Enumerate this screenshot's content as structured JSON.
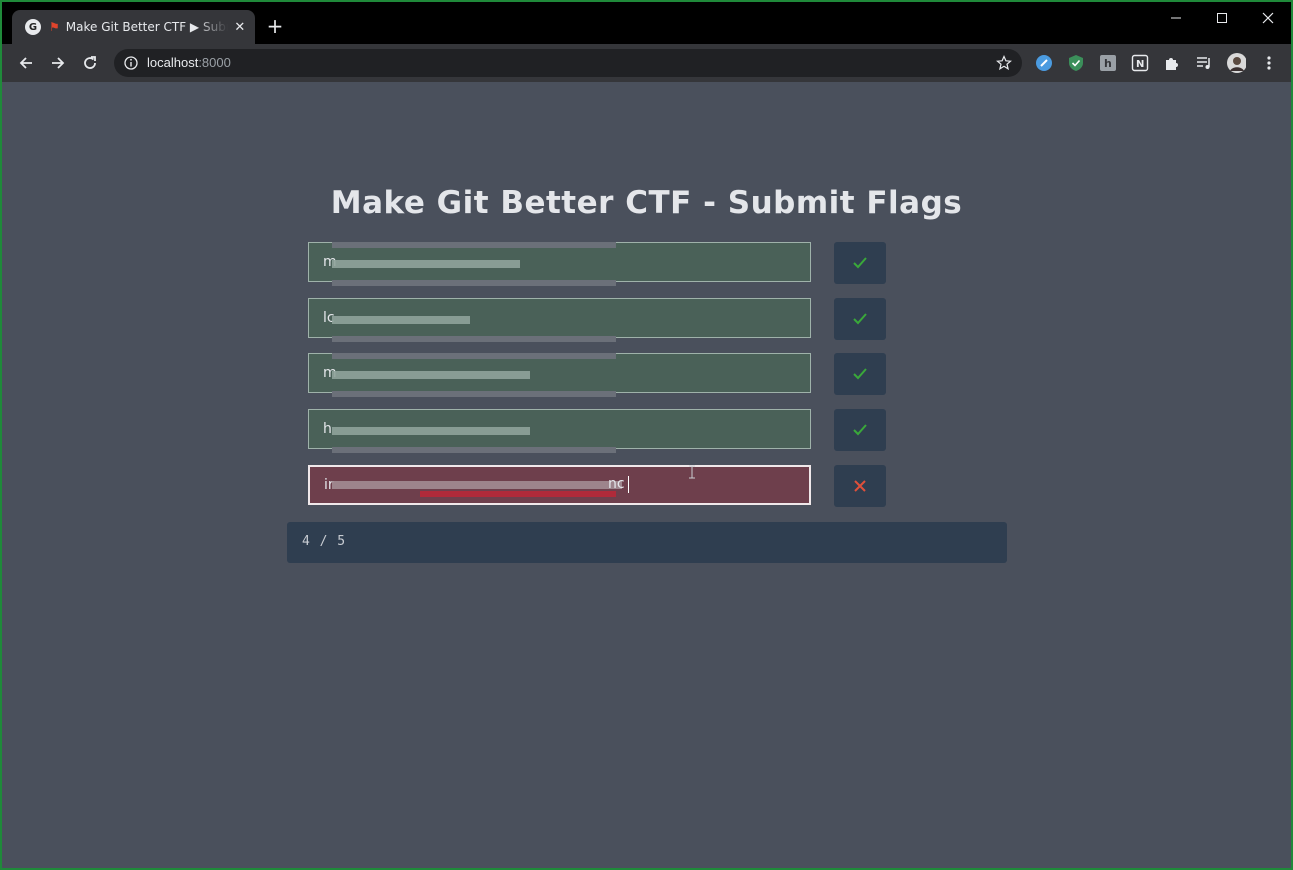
{
  "browser": {
    "tab": {
      "title": "Make Git Better CTF ▶ Submit Flags",
      "favicon_letter": "G"
    },
    "address": {
      "host": "localhost",
      "port": ":8000"
    },
    "icons": [
      "back-icon",
      "forward-icon",
      "reload-icon",
      "info-icon",
      "star-icon",
      "extension-icons",
      "puzzle-icon",
      "media-icon",
      "profile-avatar",
      "menu-icon"
    ]
  },
  "page": {
    "title": "Make Git Better CTF - Submit Flags",
    "flags": [
      {
        "value": "m",
        "status": "correct"
      },
      {
        "value": "lc",
        "status": "correct"
      },
      {
        "value": "m",
        "status": "correct"
      },
      {
        "value": "h",
        "status": "correct"
      },
      {
        "value": "ir",
        "status": "wrong",
        "suffix": "nc"
      }
    ],
    "progress": "4 / 5",
    "colors": {
      "background": "#4a505c",
      "correct_field": "#4a6158",
      "wrong_field": "#6e3f4c",
      "button": "#2f3e50",
      "check": "#3aa83a",
      "cross": "#e0503a"
    }
  }
}
